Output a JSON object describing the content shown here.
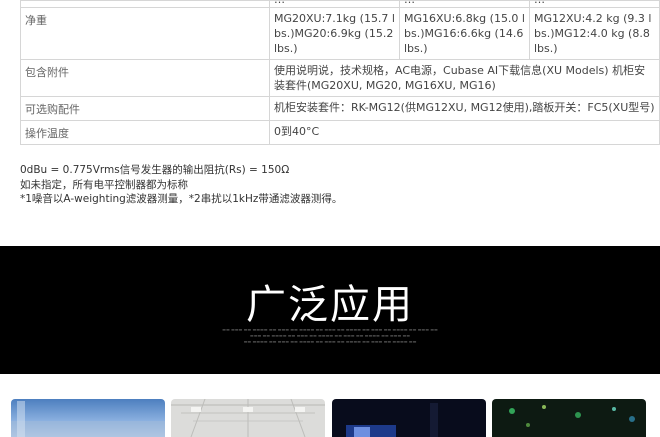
{
  "specs": {
    "top_row": {
      "mg20": "…",
      "mg16": "…",
      "mg12": "…"
    },
    "rows": [
      {
        "label": "净重",
        "mg20": "MG20XU:7.1kg (15.7 lbs.)MG20:6.9kg (15.2 lbs.)",
        "mg16": "MG16XU:6.8kg (15.0 lbs.)MG16:6.6kg (14.6 lbs.)",
        "mg12": "MG12XU:4.2 kg (9.3 lbs.)MG12:4.0 kg (8.8 lbs.)"
      },
      {
        "label": "包含附件",
        "value": "使用说明说，技术规格，AC电源，Cubase AI下载信息(XU Models) 机柜安装套件(MG20XU, MG20, MG16XU, MG16)"
      },
      {
        "label": "可选购配件",
        "value": "机柜安装套件：RK-MG12(供MG12XU, MG12使用),踏板开关：FC5(XU型号)"
      },
      {
        "label": "操作温度",
        "value": "0到40°C"
      }
    ]
  },
  "notes": [
    "0dBu = 0.775Vrms信号发生器的输出阻抗(Rs) = 150Ω",
    "如未指定，所有电平控制器都为标称",
    "*1噪音以A-weighting滤波器测量，*2串扰以1kHz带通滤波器测得。"
  ],
  "banner": {
    "title": "广泛应用"
  },
  "colors": {
    "banner_bg": "#000000",
    "table_border": "#d6d6d6"
  }
}
